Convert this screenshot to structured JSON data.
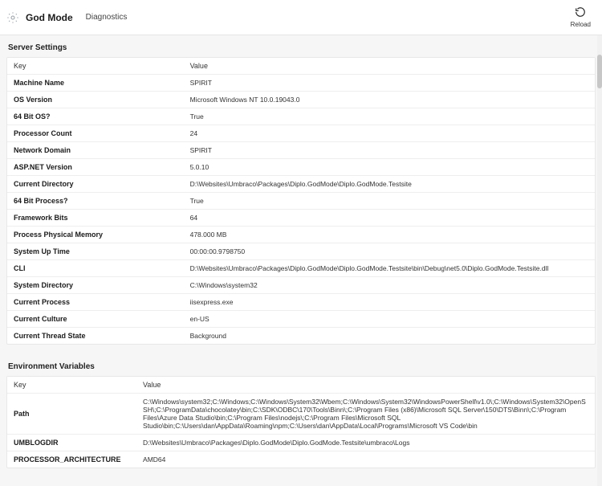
{
  "header": {
    "app_title": "God Mode",
    "breadcrumb": "Diagnostics",
    "reload_label": "Reload"
  },
  "sections": {
    "server_settings": {
      "title": "Server Settings",
      "columns": {
        "key": "Key",
        "value": "Value"
      },
      "rows": [
        {
          "k": "Machine Name",
          "v": "SPIRIT"
        },
        {
          "k": "OS Version",
          "v": "Microsoft Windows NT 10.0.19043.0"
        },
        {
          "k": "64 Bit OS?",
          "v": "True"
        },
        {
          "k": "Processor Count",
          "v": "24"
        },
        {
          "k": "Network Domain",
          "v": "SPIRIT"
        },
        {
          "k": "ASP.NET Version",
          "v": "5.0.10"
        },
        {
          "k": "Current Directory",
          "v": "D:\\Websites\\Umbraco\\Packages\\Diplo.GodMode\\Diplo.GodMode.Testsite"
        },
        {
          "k": "64 Bit Process?",
          "v": "True"
        },
        {
          "k": "Framework Bits",
          "v": "64"
        },
        {
          "k": "Process Physical Memory",
          "v": "478.000 MB"
        },
        {
          "k": "System Up Time",
          "v": "00:00:00.9798750"
        },
        {
          "k": "CLI",
          "v": "D:\\Websites\\Umbraco\\Packages\\Diplo.GodMode\\Diplo.GodMode.Testsite\\bin\\Debug\\net5.0\\Diplo.GodMode.Testsite.dll"
        },
        {
          "k": "System Directory",
          "v": "C:\\Windows\\system32"
        },
        {
          "k": "Current Process",
          "v": "iisexpress.exe"
        },
        {
          "k": "Current Culture",
          "v": "en-US"
        },
        {
          "k": "Current Thread State",
          "v": "Background"
        }
      ]
    },
    "env_vars": {
      "title": "Environment Variables",
      "columns": {
        "key": "Key",
        "value": "Value"
      },
      "rows": [
        {
          "k": "Path",
          "v": "C:\\Windows\\system32;C:\\Windows;C:\\Windows\\System32\\Wbem;C:\\Windows\\System32\\WindowsPowerShell\\v1.0\\;C:\\Windows\\System32\\OpenSSH\\;C:\\ProgramData\\chocolatey\\bin;C:\\SDK\\ODBC\\170\\Tools\\Binn\\;C:\\Program Files (x86)\\Microsoft SQL Server\\150\\DTS\\Binn\\;C:\\Program Files\\Azure Data Studio\\bin;C:\\Program Files\\nodejs\\;C:\\Program Files\\Microsoft SQL Studio\\bin;C:\\Users\\dan\\AppData\\Roaming\\npm;C:\\Users\\dan\\AppData\\Local\\Programs\\Microsoft VS Code\\bin"
        },
        {
          "k": "UMBLOGDIR",
          "v": "D:\\Websites\\Umbraco\\Packages\\Diplo.GodMode\\Diplo.GodMode.Testsite\\umbraco\\Logs"
        },
        {
          "k": "PROCESSOR_ARCHITECTURE",
          "v": "AMD64"
        }
      ]
    }
  }
}
